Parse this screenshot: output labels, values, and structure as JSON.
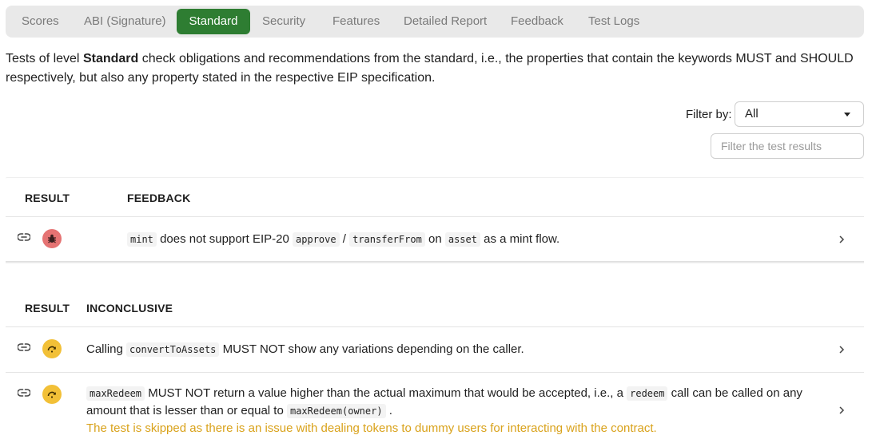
{
  "tabs": [
    {
      "label": "Scores"
    },
    {
      "label": "ABI (Signature)"
    },
    {
      "label": "Standard",
      "active": true
    },
    {
      "label": "Security"
    },
    {
      "label": "Features"
    },
    {
      "label": "Detailed Report"
    },
    {
      "label": "Feedback"
    },
    {
      "label": "Test Logs"
    }
  ],
  "intro": {
    "prefix": "Tests of level ",
    "level": "Standard",
    "suffix": " check obligations and recommendations from the standard, i.e., the properties that contain the keywords MUST and SHOULD respectively, but also any property stated in the respective EIP specification."
  },
  "filter": {
    "label": "Filter by:",
    "selected": "All",
    "search_placeholder": "Filter the test results"
  },
  "feedback_table": {
    "col_result": "RESULT",
    "col_main": "FEEDBACK",
    "rows": [
      {
        "status": "fail",
        "parts": {
          "c1": "mint",
          "t1": " does not support EIP-20 ",
          "c2": "approve",
          "t2": " / ",
          "c3": "transferFrom",
          "t3": " on ",
          "c4": "asset",
          "t4": " as a mint flow."
        }
      }
    ]
  },
  "inconclusive_table": {
    "col_result": "RESULT",
    "col_main": "INCONCLUSIVE",
    "rows": [
      {
        "status": "inconclusive",
        "parts": {
          "t1": "Calling ",
          "c1": "convertToAssets",
          "t2": " MUST NOT show any variations depending on the caller."
        }
      },
      {
        "status": "inconclusive",
        "parts": {
          "c1": "maxRedeem",
          "t1": " MUST NOT return a value higher than the actual maximum that would be accepted, i.e., a ",
          "c2": "redeem",
          "t2": " call can be called on any amount that is lesser than or equal to ",
          "c3": "maxRedeem(owner)",
          "t3": " .",
          "note": "The test is skipped as there is an issue with dealing tokens to dummy users for interacting with the contract."
        }
      }
    ]
  },
  "colors": {
    "active_tab": "#2e7d32",
    "fail": "#e57373",
    "inconclusive": "#f2c037",
    "warning_text": "#d9a21b"
  },
  "icons": {
    "row_link": "link-icon",
    "fail": "bug-icon",
    "inconclusive": "skip-icon",
    "expand": "chevron-right-icon"
  }
}
